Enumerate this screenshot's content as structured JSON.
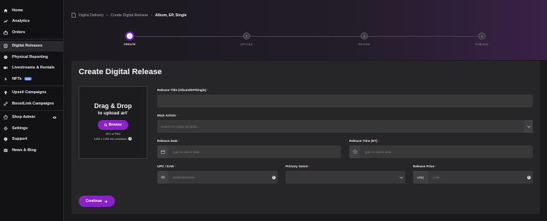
{
  "sidebar": {
    "items": [
      {
        "label": "Home",
        "icon": "home-icon"
      },
      {
        "label": "Analytics",
        "icon": "analytics-icon"
      },
      {
        "label": "Orders",
        "icon": "orders-icon"
      },
      {
        "label": "Digital Releases",
        "icon": "digital-releases-icon",
        "active": true
      },
      {
        "label": "Physical Reporting",
        "icon": "physical-reporting-icon"
      },
      {
        "label": "Livestreams & Rentals",
        "icon": "livestream-icon"
      },
      {
        "label": "NFTs",
        "icon": "nft-icon",
        "badge": "beta"
      },
      {
        "label": "Upsell Campaigns",
        "icon": "upsell-icon"
      },
      {
        "label": "BoostLink Campaigns",
        "icon": "boostlink-icon"
      },
      {
        "label": "Shop Admin",
        "icon": "shop-admin-icon"
      },
      {
        "label": "Settings",
        "icon": "settings-icon"
      },
      {
        "label": "Support",
        "icon": "support-icon"
      },
      {
        "label": "News & Blog",
        "icon": "news-icon"
      }
    ]
  },
  "breadcrumb": [
    "Digital Delivery",
    "Create Digital Release",
    "Album, EP, Single"
  ],
  "steps": [
    {
      "number": "1",
      "label": "CREATE",
      "active": true
    },
    {
      "number": "2",
      "label": "UPLOAD"
    },
    {
      "number": "3",
      "label": "REVIEW"
    },
    {
      "number": "4",
      "label": "PUBLISH"
    }
  ],
  "page_title": "Create Digital Release",
  "upload": {
    "heading": "Drag & Drop",
    "subheading": "to upload art",
    "browse_label": "Browse",
    "formats": "JPG or PNG",
    "resolution": "1400 x 1400 min resolution"
  },
  "form": {
    "release_title": {
      "label": "Release Title (Album/EP/Single)",
      "value": ""
    },
    "main_artists": {
      "label": "Main Artists",
      "placeholder": "search or create an artist"
    },
    "release_date": {
      "label": "Release Date",
      "placeholder": "type or select date"
    },
    "release_time": {
      "label": "Release Time (ET)",
      "placeholder": "type or select time"
    },
    "upc": {
      "label": "UPC / EAN",
      "placeholder": "000000000000"
    },
    "genre": {
      "label": "Primary Genre",
      "value": ""
    },
    "price": {
      "label": "Release Price",
      "currency": "USD",
      "placeholder": "4.99"
    }
  },
  "continue_label": "Continue",
  "colors": {
    "accent": "#8a22c8",
    "required": "#e0457b",
    "beta": "#3c7fe0"
  }
}
